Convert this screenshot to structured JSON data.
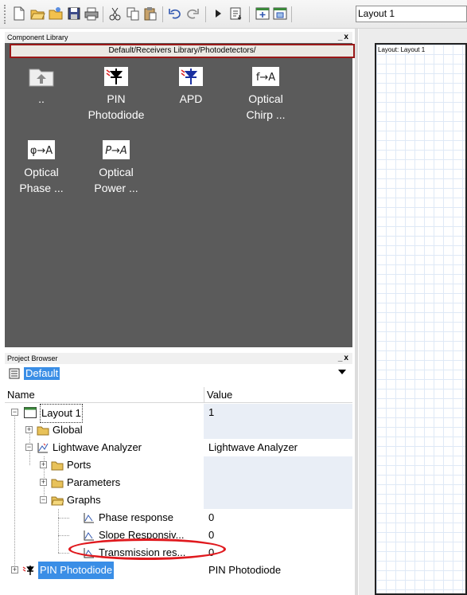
{
  "toolbar": {
    "layout_select_value": "Layout 1",
    "buttons": [
      "new-file-icon",
      "open-folder-icon",
      "open-samples-icon",
      "save-icon",
      "print-icon",
      "cut-icon",
      "copy-icon",
      "paste-icon",
      "undo-icon",
      "redo-icon",
      "run-icon",
      "report-icon",
      "layout-add-icon",
      "layout-props-icon"
    ]
  },
  "component_library": {
    "title": "Component Library",
    "window_buttons": "_x",
    "path": "Default/Receivers Library/Photodetectors/",
    "items": [
      {
        "label": "..",
        "icon": "parent-folder-icon"
      },
      {
        "label": "PIN Photodiode",
        "line1": "PIN",
        "line2": "Photodiode",
        "icon": "photodiode-icon"
      },
      {
        "label": "APD",
        "line1": "APD",
        "line2": "",
        "icon": "avalanche-photodiode-icon"
      },
      {
        "label": "Optical Chirp ...",
        "line1": "Optical",
        "line2": "Chirp ...",
        "icon": "optical-chirp-icon",
        "icon_text": "f→A"
      },
      {
        "label": "Optical Phase ...",
        "line1": "Optical",
        "line2": "Phase ...",
        "icon": "optical-phase-icon",
        "icon_text": "φ→A"
      },
      {
        "label": "Optical Power ...",
        "line1": "Optical",
        "line2": "Power ...",
        "icon": "optical-power-icon",
        "icon_text": "P→A"
      }
    ]
  },
  "project_browser": {
    "title": "Project Browser",
    "window_buttons": "_x",
    "project": "Default",
    "columns": {
      "name": "Name",
      "value": "Value"
    },
    "rows": [
      {
        "name": "Layout 1",
        "value": "1"
      },
      {
        "name": "Global",
        "value": ""
      },
      {
        "name": "Lightwave Analyzer",
        "value": "Lightwave Analyzer"
      },
      {
        "name": "Ports",
        "value": ""
      },
      {
        "name": "Parameters",
        "value": ""
      },
      {
        "name": "Graphs",
        "value": ""
      },
      {
        "name": "Phase response",
        "value": "0"
      },
      {
        "name": "Slope Responsiv...",
        "value": "0"
      },
      {
        "name": "Transmission res...",
        "value": "0"
      },
      {
        "name": "PIN Photodiode",
        "value": "PIN Photodiode"
      }
    ]
  },
  "layout_view": {
    "label": "Layout: Layout 1"
  },
  "colors": {
    "selection": "#3a8ee6",
    "highlight_oval": "#e0191e",
    "library_bg": "#5b5b5b",
    "path_border": "#9a1818"
  }
}
